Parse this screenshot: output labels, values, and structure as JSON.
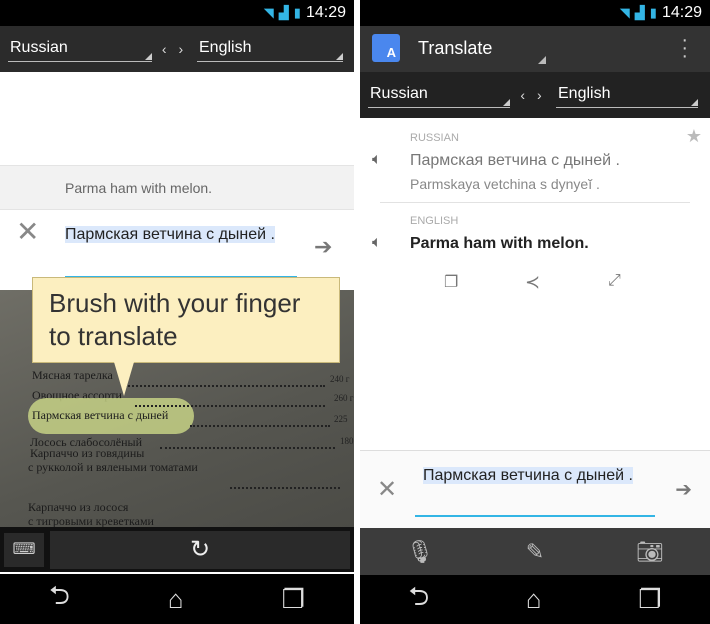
{
  "status": {
    "time": "14:29"
  },
  "left": {
    "source_lang": "Russian",
    "target_lang": "English",
    "swap": "‹ ›",
    "translation": "Parma ham with melon.",
    "input_text": "Пармская ветчина с дыней .",
    "tooltip": "Brush with your finger to translate",
    "menu_lines": [
      "Мясная тарелка",
      "Овощное ассорти",
      "Пармская ветчина с дыней",
      "Лосось слабосолёный",
      "Карпаччо из говядины",
      "с рукколой и вялеными томатами",
      "Карпаччо из лосося",
      "с тигровыми креветками"
    ],
    "prices": [
      "240 г",
      "260 г",
      "225",
      "180"
    ]
  },
  "right": {
    "app_title": "Translate",
    "source_lang": "Russian",
    "target_lang": "English",
    "swap": "‹ ›",
    "source_label": "RUSSIAN",
    "source_text": "Пармская ветчина с дыней .",
    "transliteration": "Parmskaya vetchina s dynyeĭ .",
    "target_label": "ENGLISH",
    "target_text": "Parma ham with melon.",
    "input_text": "Пармская ветчина с дыней ."
  }
}
